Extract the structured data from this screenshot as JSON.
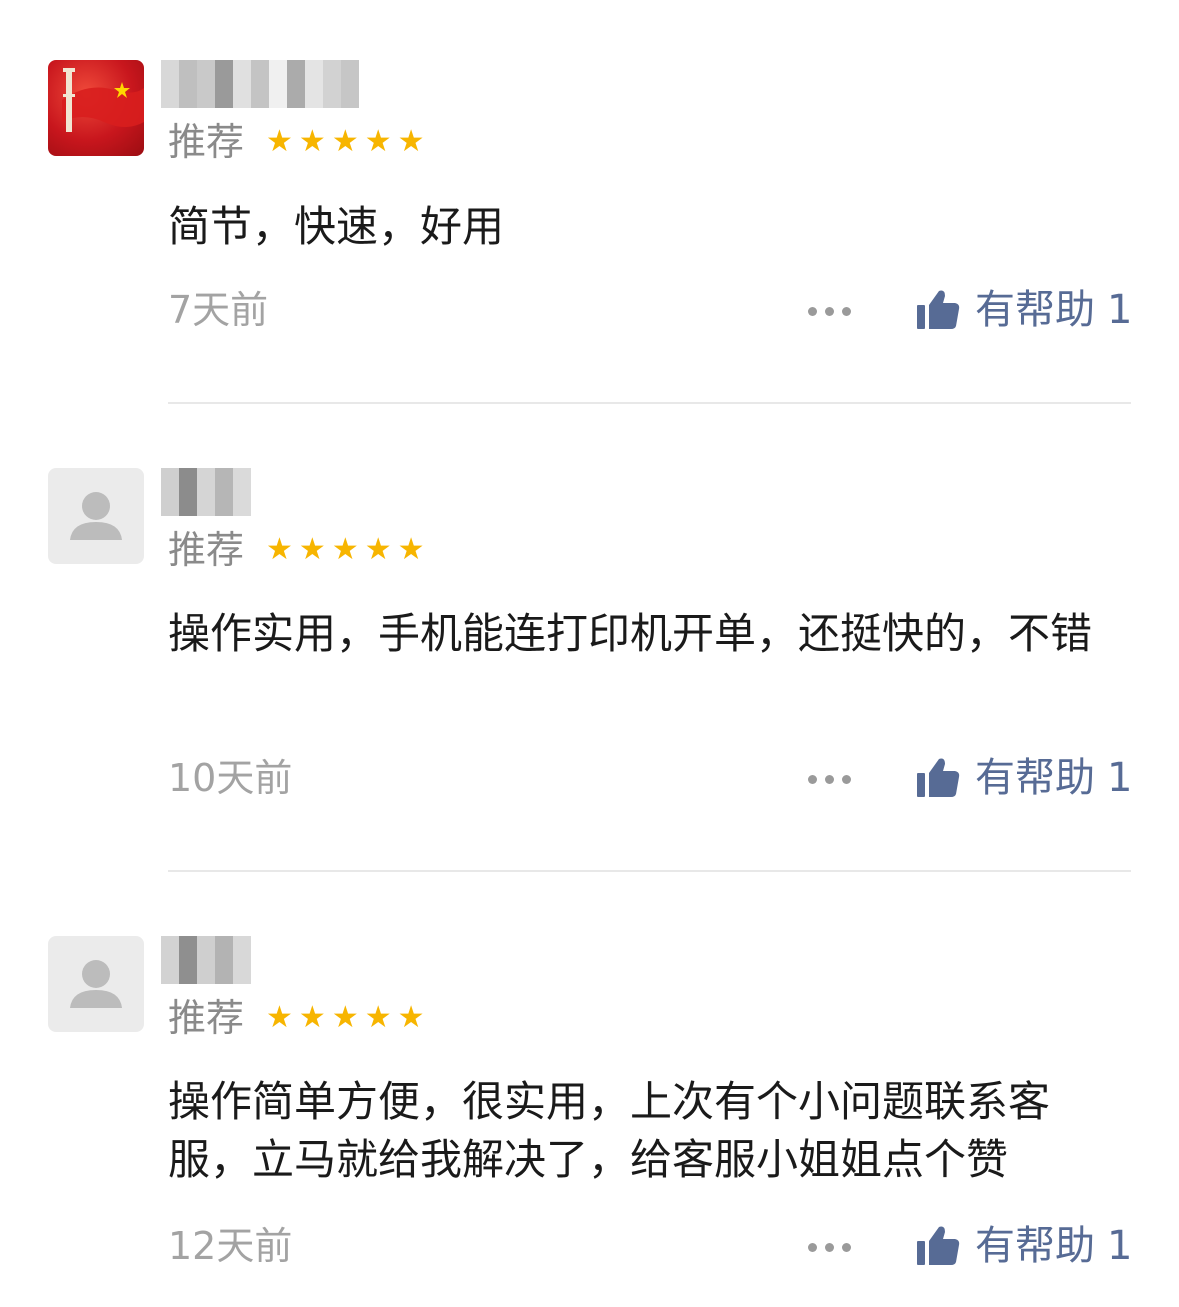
{
  "reviews": [
    {
      "avatar": "flag-avatar",
      "recommendation": "推荐",
      "stars": 5,
      "comment": "简节，快速，好用",
      "time": "7天前",
      "helpful_label": "有帮助",
      "helpful_count": "1"
    },
    {
      "avatar": "default-user-avatar",
      "recommendation": "推荐",
      "stars": 5,
      "comment": "操作实用，手机能连打印机开单，还挺快的，不错",
      "time": "10天前",
      "helpful_label": "有帮助",
      "helpful_count": "1"
    },
    {
      "avatar": "default-user-avatar",
      "recommendation": "推荐",
      "stars": 5,
      "comment": "操作简单方便，很实用，上次有个小问题联系客服，立马就给我解决了，给客服小姐姐点个赞",
      "time": "12天前",
      "helpful_label": "有帮助",
      "helpful_count": "1"
    }
  ],
  "colors": {
    "star": "#f7b500",
    "helpful_link": "#576b95",
    "meta_text": "#a3a3a3",
    "divider": "#e8e8e8"
  }
}
